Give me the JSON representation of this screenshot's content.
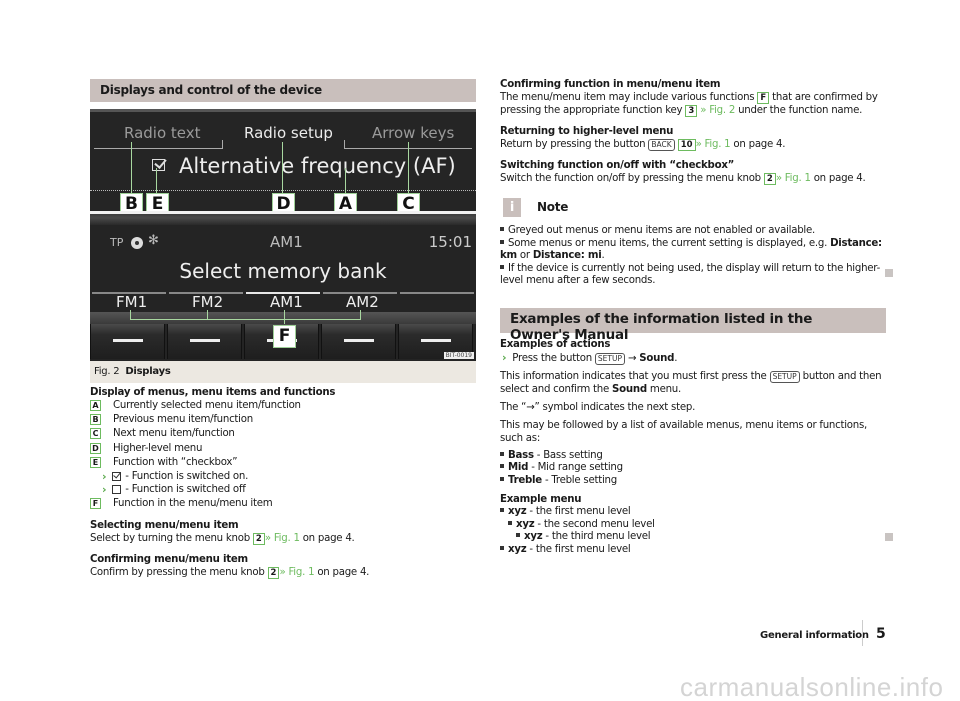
{
  "left": {
    "section_title": "Displays and control of the device",
    "figure": {
      "screen_top": {
        "tabs": [
          "Radio text",
          "Radio setup",
          "Arrow keys"
        ],
        "active_tab": "Radio setup",
        "menu_item": "Alternative frequency (AF)",
        "menu_item_checked": true
      },
      "screen_bottom": {
        "status_tp": "TP",
        "status_icons": [
          "cd-icon",
          "bluetooth-icon"
        ],
        "band": "AM1",
        "time": "15:01",
        "title": "Select memory bank",
        "function_keys": [
          "FM1",
          "FM2",
          "AM1",
          "AM2",
          ""
        ],
        "active_function": "AM1"
      },
      "callouts": [
        "B",
        "E",
        "D",
        "A",
        "C",
        "F"
      ],
      "image_code": "BIT-0019",
      "caption_num": "Fig. 2",
      "caption_title": "Displays"
    },
    "legend_title": "Display of menus, menu items and functions",
    "legend": [
      {
        "key": "A",
        "text": "Currently selected menu item/function"
      },
      {
        "key": "B",
        "text": "Previous menu item/function"
      },
      {
        "key": "C",
        "text": "Next menu item/function"
      },
      {
        "key": "D",
        "text": "Higher-level menu"
      },
      {
        "key": "E",
        "text": "Function with “checkbox”"
      },
      {
        "key": "F",
        "text": "Function in the menu/menu item"
      }
    ],
    "legend_sub": [
      {
        "checked": true,
        "text": "- Function is switched on."
      },
      {
        "checked": false,
        "text": "- Function is switched off"
      }
    ],
    "select_head": "Selecting menu/menu item",
    "select_text_a": "Select by turning the menu knob",
    "select_key": "2",
    "select_ref": "» Fig. 1",
    "select_text_b": "on page 4.",
    "confirm_head": "Confirming menu/menu item",
    "confirm_text_a": "Confirm by pressing the menu knob",
    "confirm_key": "2",
    "confirm_ref": "» Fig. 1",
    "confirm_text_b": "on page 4."
  },
  "right": {
    "cf_head": "Confirming function in menu/menu item",
    "cf_text_a": "The menu/menu item may include various functions",
    "cf_key_f": "F",
    "cf_text_b": "that are confirmed by pressing the appropriate function key",
    "cf_key_3": "3",
    "cf_ref": "» Fig. 2",
    "cf_text_c": "under the function name.",
    "ret_head": "Returning to higher-level menu",
    "ret_text_a": "Return by pressing the button",
    "ret_btn": "BACK",
    "ret_key": "10",
    "ret_ref": "» Fig. 1",
    "ret_text_b": "on page 4.",
    "sw_head": "Switching function on/off with “checkbox”",
    "sw_text_a": "Switch the function on/off by pressing the menu knob",
    "sw_key": "2",
    "sw_ref": "» Fig. 1",
    "sw_text_b": "on page 4.",
    "note": {
      "icon": "i",
      "title": "Note",
      "item1": "Greyed out menus or menu items are not enabled or available.",
      "item2_a": "Some menus or menu items, the current setting is displayed, e.g.",
      "item2_b1": "Distance: km",
      "item2_or": "or",
      "item2_b2": "Distance: mi",
      "item2_end": ".",
      "item3": "If the device is currently not being used, the display will return to the higher-level menu after a few seconds."
    },
    "examples": {
      "section_title": "Examples of the information listed in the Owner's Manual",
      "actions_head": "Examples of actions",
      "action_text": "Press the button",
      "action_btn": "SETUP",
      "action_arrow": "→",
      "action_target": "Sound",
      "info_a": "This information indicates that you must first press the",
      "info_btn": "SETUP",
      "info_b": "button and then select and confirm the",
      "info_bold": "Sound",
      "info_c": "menu.",
      "arrow_text": "The “→” symbol indicates the next step.",
      "followed_text": "This may be followed by a list of available menus, menu items or functions, such as:",
      "list": [
        {
          "bold": "Bass",
          "text": "- Bass setting"
        },
        {
          "bold": "Mid",
          "text": "- Mid range setting"
        },
        {
          "bold": "Treble",
          "text": "- Treble setting"
        }
      ],
      "menu_head": "Example menu",
      "menu": [
        {
          "bold": "xyz",
          "text": "- the first menu level"
        },
        {
          "bold": "xyz",
          "text": "- the second menu level"
        },
        {
          "bold": "xyz",
          "text": "- the third menu level"
        },
        {
          "bold": "xyz",
          "text": "- the first menu level"
        }
      ]
    }
  },
  "footer": {
    "section": "General information",
    "page": "5",
    "watermark": "carmanualsonline.info"
  },
  "colors": {
    "accent_green": "#6dbb5f",
    "section_bg": "#c9bfbc"
  }
}
